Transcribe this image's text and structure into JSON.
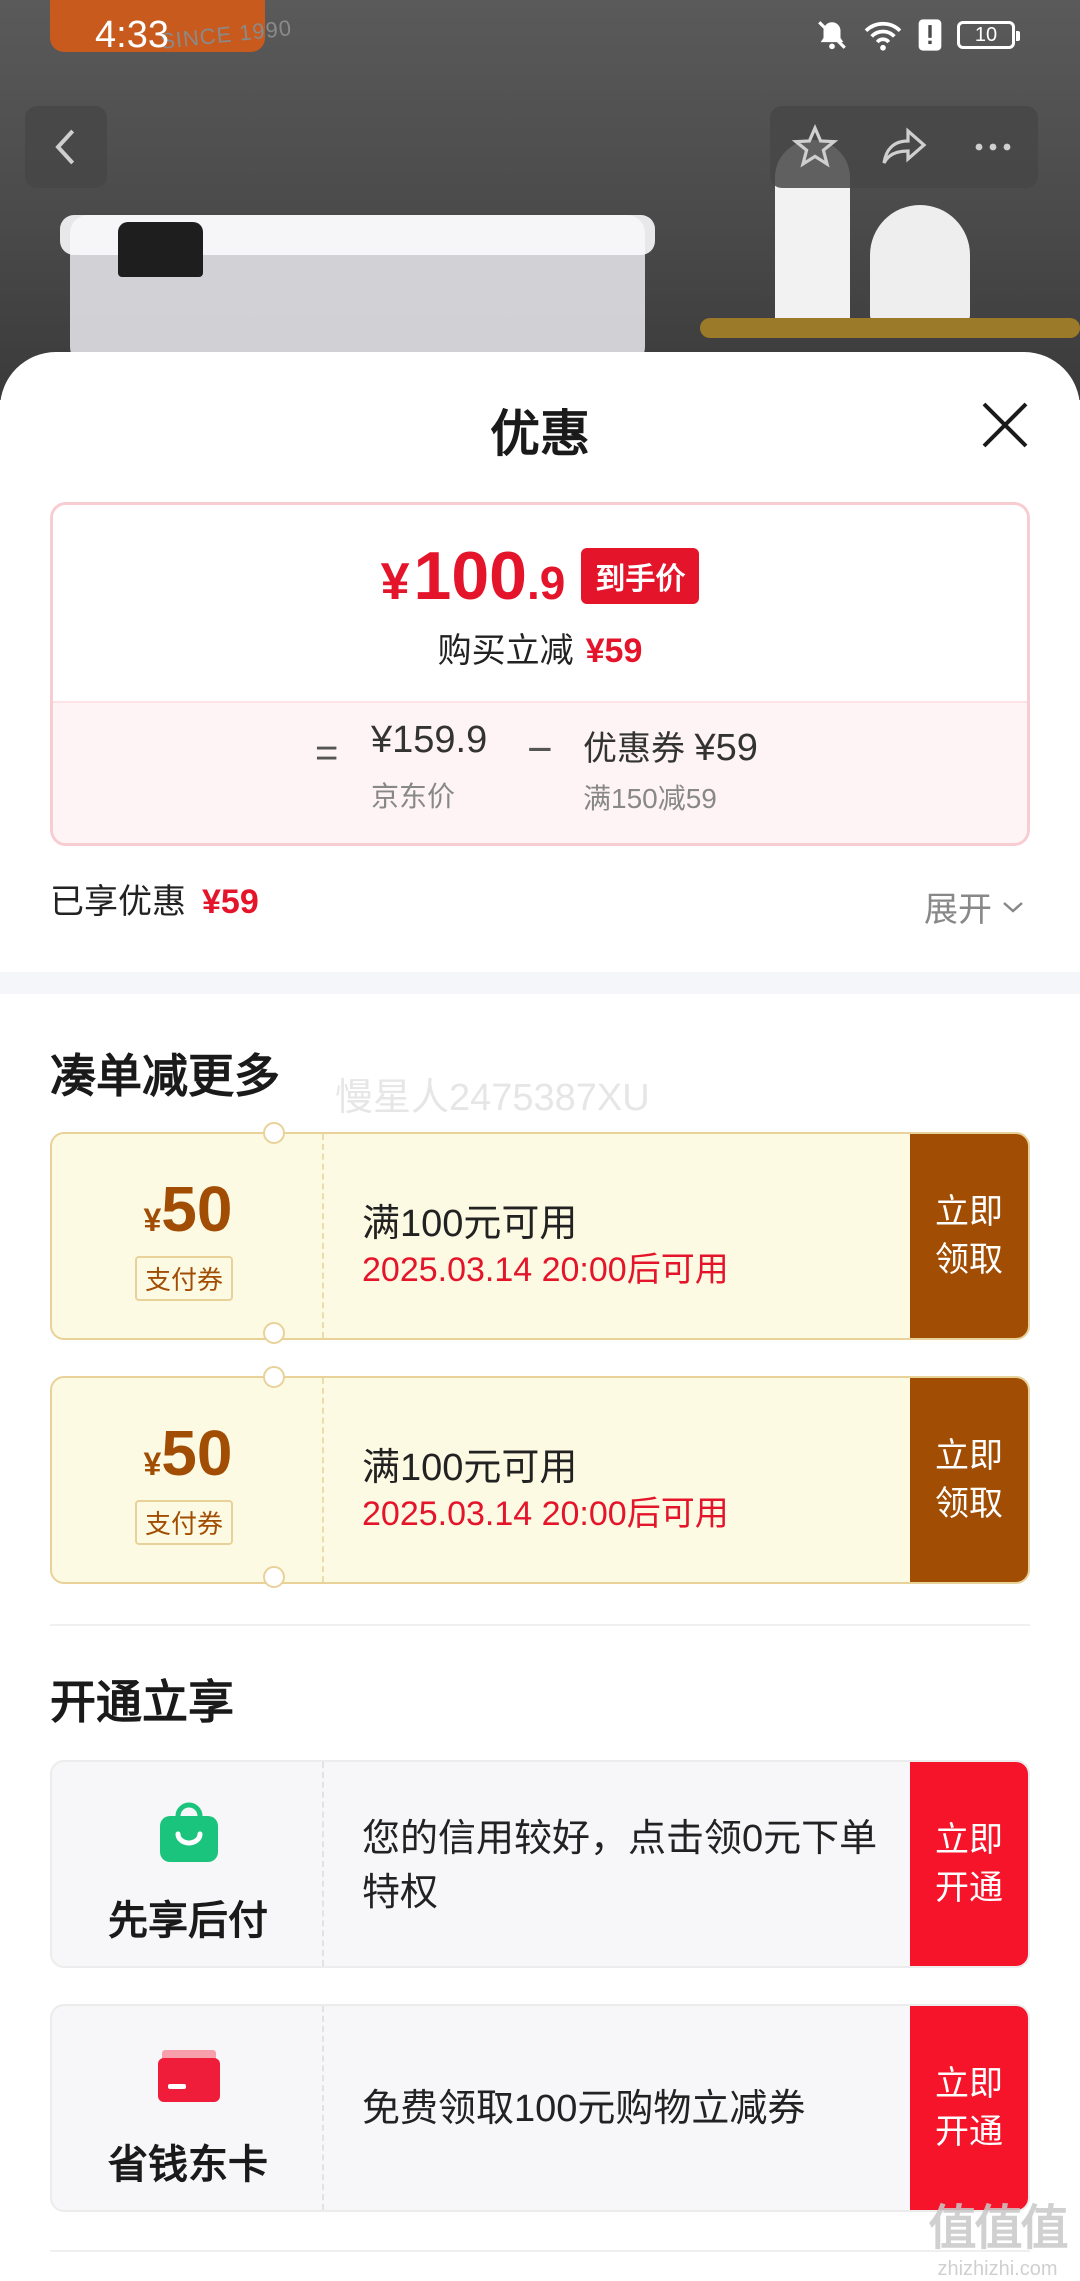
{
  "status_bar": {
    "time": "4:33",
    "battery": "10"
  },
  "background": {
    "since_text": "SINCE 1990"
  },
  "sheet": {
    "title": "优惠",
    "price_card": {
      "currency": "¥",
      "price_int": "100",
      "price_dec": ".9",
      "price_tag": "到手价",
      "reduce_label": "购买立减",
      "reduce_value": "¥59",
      "equals": "=",
      "jd_price": "¥159.9",
      "jd_label": "京东价",
      "minus": "−",
      "coupon_label": "优惠券",
      "coupon_value": "¥59",
      "coupon_rule": "满150减59"
    },
    "enjoyed_label": "已享优惠",
    "enjoyed_value": "¥59",
    "expand_label": "展开",
    "bundle_section": {
      "title": "凑单减更多",
      "coupons": [
        {
          "currency": "¥",
          "amount": "50",
          "type": "支付券",
          "condition": "满100元可用",
          "date": "2025.03.14 20:00后可用",
          "button_line1": "立即",
          "button_line2": "领取"
        },
        {
          "currency": "¥",
          "amount": "50",
          "type": "支付券",
          "condition": "满100元可用",
          "date": "2025.03.14 20:00后可用",
          "button_line1": "立即",
          "button_line2": "领取"
        }
      ]
    },
    "watermark": "慢星人2475387XU",
    "open_section": {
      "title": "开通立享",
      "items": [
        {
          "name": "先享后付",
          "icon": "shopping-bag-icon",
          "text": "您的信用较好，点击领0元下单特权",
          "button_line1": "立即",
          "button_line2": "开通"
        },
        {
          "name": "省钱东卡",
          "icon": "card-icon",
          "text": "免费领取100元购物立减券",
          "button_line1": "立即",
          "button_line2": "开通"
        }
      ]
    }
  },
  "site_watermark": {
    "big": "值值值",
    "small": "zhizhizhi.com"
  },
  "colors": {
    "accent_red": "#e4152b",
    "coupon_brown": "#a14e04",
    "coupon_bg": "#fdfae3",
    "open_red": "#f5142a",
    "bag_green": "#1bc47d"
  }
}
